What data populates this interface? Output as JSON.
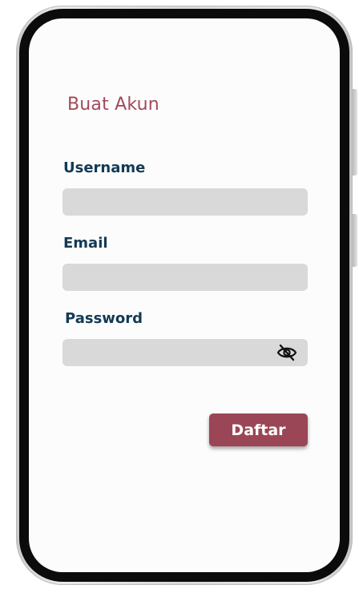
{
  "screen": {
    "title": "Buat Akun"
  },
  "form": {
    "username": {
      "label": "Username",
      "value": "",
      "placeholder": ""
    },
    "email": {
      "label": "Email",
      "value": "",
      "placeholder": ""
    },
    "password": {
      "label": "Password",
      "value": "",
      "placeholder": "",
      "toggle_icon": "eye-slash-icon"
    },
    "submit_label": "Daftar"
  },
  "colors": {
    "accent": "#9b4656",
    "title": "#a14a5b",
    "label": "#123a55",
    "input_bg": "#d9d9d9"
  }
}
